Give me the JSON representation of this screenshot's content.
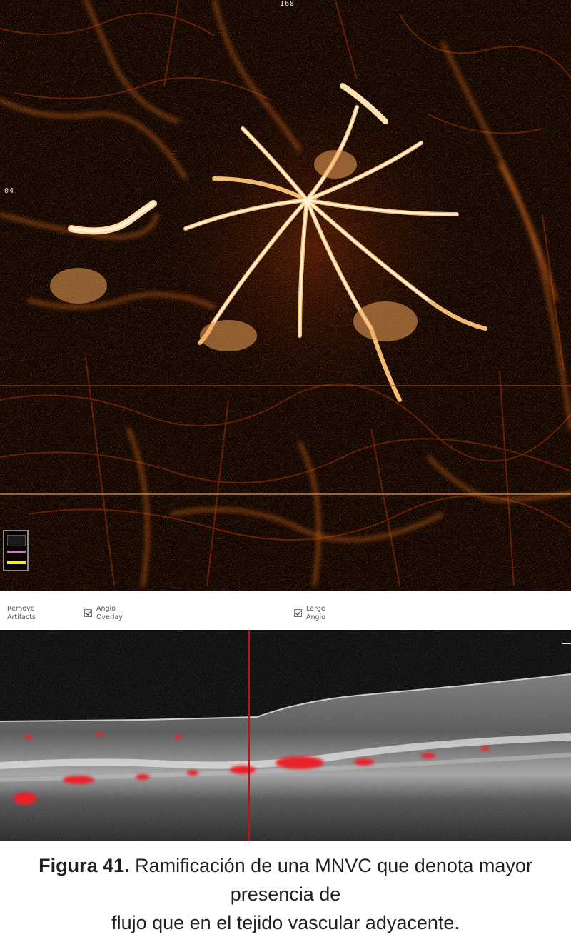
{
  "angio_panel": {
    "scale_top": "168",
    "scale_left": "04"
  },
  "toolbar": {
    "remove_artifacts_line1": "Remove",
    "remove_artifacts_line2": "Artifacts",
    "angio_overlay_line1": "Angio",
    "angio_overlay_line2": "Overlay",
    "large_angio_line1": "Large",
    "large_angio_line2": "Angio"
  },
  "caption": {
    "figure_label": "Figura 41.",
    "line1_text": " Ramificación de una MNVC que denota mayor presencia de",
    "line2_text": "flujo que en el tejido vascular adyacente."
  },
  "colors": {
    "angio_background": "#0b0100",
    "vessel_bright": "#ffe7b8",
    "vessel_mid": "#e0782a",
    "vessel_dim": "#7a2a08",
    "flow_overlay": "#e8242a",
    "cursor_line": "#b01818",
    "caption_text": "#231f20"
  }
}
